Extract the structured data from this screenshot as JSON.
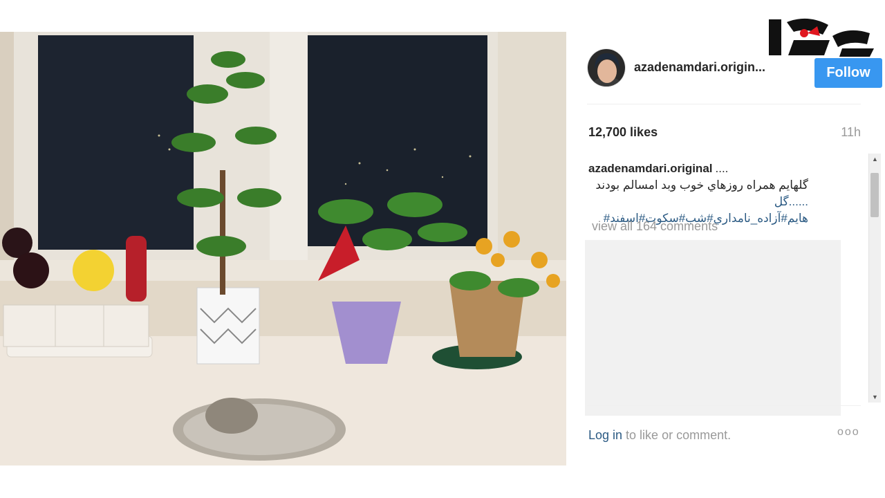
{
  "logo": {
    "brand": "rokna"
  },
  "post": {
    "username": "azadenamdari.origin...",
    "follow_label": "Follow",
    "likes": "12,700 likes",
    "time": "11h",
    "caption_user": "azadenamdari.original",
    "caption_dots": "....",
    "caption_line": "گلهایم همراه روزهاي خوب وبد امسالم بودند",
    "caption_tags": "......گل هایم#آزاده_نامداري#شب#سكوت#اسفند#",
    "view_all": "view all 164 comments",
    "login_link": "Log in",
    "login_text": " to like or comment.",
    "more_icon_label": "ooo"
  },
  "colors": {
    "follow_bg": "#3897f0",
    "link": "#2b5a83",
    "muted": "#999999",
    "logo_red": "#e0171f"
  }
}
